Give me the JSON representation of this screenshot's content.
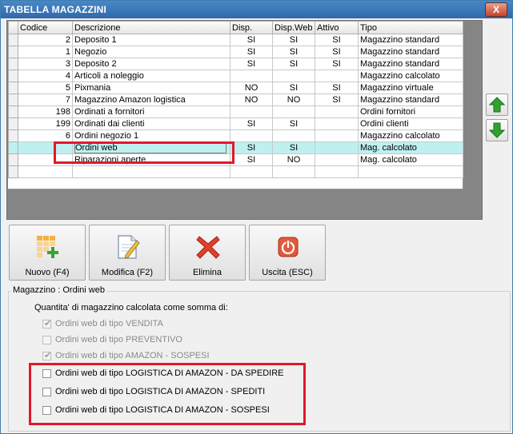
{
  "window": {
    "title": "TABELLA MAGAZZINI",
    "close_label": "X"
  },
  "table": {
    "columns": [
      "Codice",
      "Descrizione",
      "Disp.",
      "Disp.Web",
      "Attivo",
      "Tipo"
    ],
    "rows": [
      {
        "codice": "2",
        "descrizione": "Deposito 1",
        "disp": "SI",
        "dispweb": "SI",
        "attivo": "SI",
        "tipo": "Magazzino standard"
      },
      {
        "codice": "1",
        "descrizione": "Negozio",
        "disp": "SI",
        "dispweb": "SI",
        "attivo": "SI",
        "tipo": "Magazzino standard"
      },
      {
        "codice": "3",
        "descrizione": "Deposito 2",
        "disp": "SI",
        "dispweb": "SI",
        "attivo": "SI",
        "tipo": "Magazzino standard"
      },
      {
        "codice": "4",
        "descrizione": "Articoli a noleggio",
        "disp": "",
        "dispweb": "",
        "attivo": "",
        "tipo": "Magazzino calcolato"
      },
      {
        "codice": "5",
        "descrizione": "Pixmania",
        "disp": "NO",
        "dispweb": "SI",
        "attivo": "SI",
        "tipo": "Magazzino virtuale"
      },
      {
        "codice": "7",
        "descrizione": "Magazzino Amazon logistica",
        "disp": "NO",
        "dispweb": "NO",
        "attivo": "SI",
        "tipo": "Magazzino standard"
      },
      {
        "codice": "198",
        "descrizione": "Ordinati a fornitori",
        "disp": "",
        "dispweb": "",
        "attivo": "",
        "tipo": "Ordini fornitori"
      },
      {
        "codice": "199",
        "descrizione": "Ordinati dai clienti",
        "disp": "SI",
        "dispweb": "SI",
        "attivo": "",
        "tipo": "Ordini clienti"
      },
      {
        "codice": "6",
        "descrizione": "Ordini negozio 1",
        "disp": "",
        "dispweb": "",
        "attivo": "",
        "tipo": "Magazzino calcolato"
      },
      {
        "codice": "",
        "descrizione": "Ordini web",
        "disp": "SI",
        "dispweb": "SI",
        "attivo": "",
        "tipo": "Mag. calcolato",
        "selected": true
      },
      {
        "codice": "",
        "descrizione": "Riparazioni aperte",
        "disp": "SI",
        "dispweb": "NO",
        "attivo": "",
        "tipo": "Mag. calcolato"
      },
      {
        "codice": "",
        "descrizione": "",
        "disp": "",
        "dispweb": "",
        "attivo": "",
        "tipo": ""
      }
    ]
  },
  "toolbar": {
    "new_label": "Nuovo (F4)",
    "edit_label": "Modifica (F2)",
    "delete_label": "Elimina",
    "exit_label": "Uscita (ESC)"
  },
  "group": {
    "title": "Magazzino : Ordini web",
    "subtitle": "Quantita' di magazzino calcolata come somma di:",
    "options": [
      {
        "label": "Ordini web di tipo VENDITA",
        "checked": true,
        "disabled": true
      },
      {
        "label": "Ordini web di tipo PREVENTIVO",
        "checked": false,
        "disabled": true
      },
      {
        "label": "Ordini web di tipo AMAZON - SOSPESI",
        "checked": true,
        "disabled": true
      },
      {
        "label": "Ordini web di tipo LOGISTICA DI AMAZON - DA SPEDIRE",
        "checked": false,
        "disabled": false
      },
      {
        "label": "Ordini web di tipo LOGISTICA DI AMAZON - SPEDITI",
        "checked": false,
        "disabled": false
      },
      {
        "label": "Ordini web di tipo LOGISTICA DI AMAZON - SOSPESI",
        "checked": false,
        "disabled": false
      }
    ]
  },
  "colors": {
    "titlebar": "#2e69ac",
    "selected_row": "#bff0f0",
    "highlight": "#e0192a",
    "arrow_green": "#2fa32f"
  }
}
